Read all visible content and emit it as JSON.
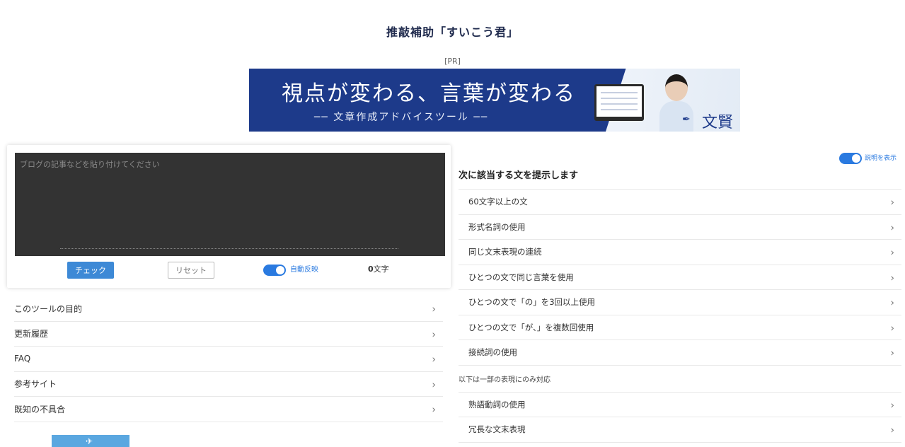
{
  "header": {
    "title": "推敲補助「すいこう君」",
    "pr": "[PR]"
  },
  "banner": {
    "headline": "視点が変わる、言葉が変わる",
    "subline": "── 文章作成アドバイスツール ──",
    "brand": "文賢",
    "bg_color": "#1d3a8a"
  },
  "editor": {
    "placeholder": "ブログの記事などを貼り付けてください",
    "value": "",
    "check_label": "チェック",
    "reset_label": "リセット",
    "auto_label": "自動反映",
    "auto_on": true,
    "count_value": "0",
    "count_unit": "文字",
    "accent": "#3d89d6"
  },
  "left_menu": [
    {
      "label": "このツールの目的"
    },
    {
      "label": "更新履歴"
    },
    {
      "label": "FAQ"
    },
    {
      "label": "参考サイト"
    },
    {
      "label": "既知の不具合"
    }
  ],
  "right_panel": {
    "show_label": "説明を表示",
    "show_on": true,
    "heading": "次に該当する文を提示します",
    "items": [
      {
        "label": "60文字以上の文"
      },
      {
        "label": "形式名詞の使用"
      },
      {
        "label": "同じ文末表現の連続"
      },
      {
        "label": "ひとつの文で同じ言葉を使用"
      },
      {
        "label": "ひとつの文で「の」を3回以上使用"
      },
      {
        "label": "ひとつの文で「が、」を複数回使用"
      },
      {
        "label": "接続詞の使用"
      }
    ],
    "note": "以下は一部の表現にのみ対応",
    "items2": [
      {
        "label": "熟語動詞の使用"
      },
      {
        "label": "冗長な文末表現"
      }
    ]
  },
  "icons": {
    "chevron": "chevron-right-icon",
    "toggle_color": "#2a7ae0"
  }
}
